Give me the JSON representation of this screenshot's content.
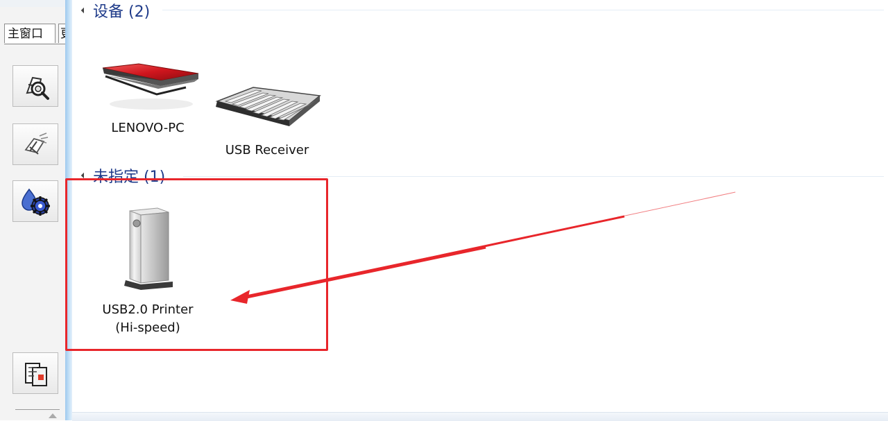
{
  "left_panel": {
    "tabs": [
      {
        "label": "主窗口",
        "active": true
      },
      {
        "label": "更",
        "active": false
      }
    ],
    "tool_buttons": [
      {
        "icon": "search-devices-icon"
      },
      {
        "icon": "remove-device-icon"
      },
      {
        "icon": "settings-gear-icon"
      },
      {
        "icon": "document-icon"
      }
    ]
  },
  "groups": [
    {
      "title": "设备 (2)",
      "devices": [
        {
          "name": "LENOVO-PC",
          "icon": "laptop-icon"
        },
        {
          "name": "USB Receiver",
          "icon": "keyboard-icon"
        }
      ]
    },
    {
      "title": "未指定 (1)",
      "devices": [
        {
          "name_line1": "USB2.0 Printer",
          "name_line2": "(Hi-speed)",
          "icon": "printer-box-icon"
        }
      ]
    }
  ],
  "colors": {
    "header_text": "#1f3b8a",
    "annotation": "#e8262b",
    "divider": "#9ec9ee"
  }
}
